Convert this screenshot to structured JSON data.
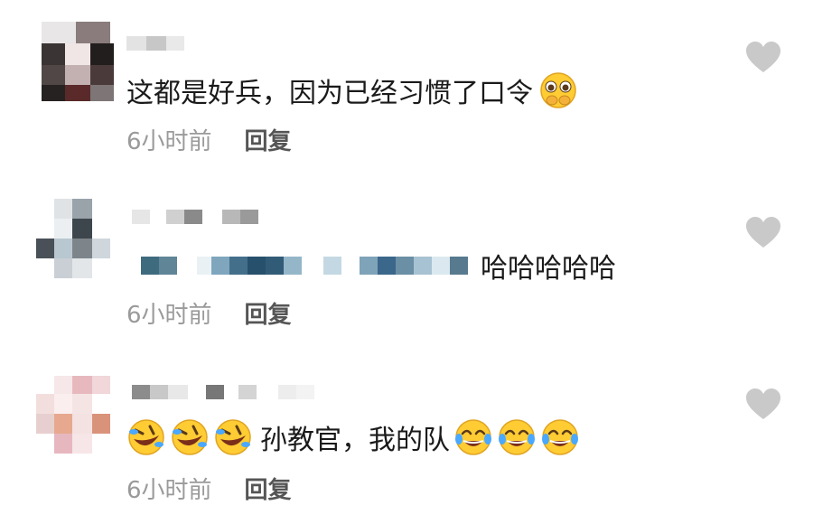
{
  "comments": [
    {
      "text": "这都是好兵，因为已经习惯了口令",
      "time": "6小时前",
      "reply_label": "回复",
      "emoji_after": [
        "pleading-face-icon"
      ]
    },
    {
      "text": "哈哈哈哈哈",
      "time": "6小时前",
      "reply_label": "回复"
    },
    {
      "text": "孙教官，我的队",
      "time": "6小时前",
      "reply_label": "回复",
      "emoji_before": [
        "rolling-laughing-icon",
        "rolling-laughing-icon",
        "rolling-laughing-icon"
      ],
      "emoji_after": [
        "tears-of-joy-icon",
        "tears-of-joy-icon",
        "tears-of-joy-icon"
      ]
    }
  ],
  "colors": {
    "text": "#1a1a1a",
    "meta": "#9a9a9a",
    "like": "#c9c9c9",
    "emoji_yellow": "#ffcc33"
  }
}
